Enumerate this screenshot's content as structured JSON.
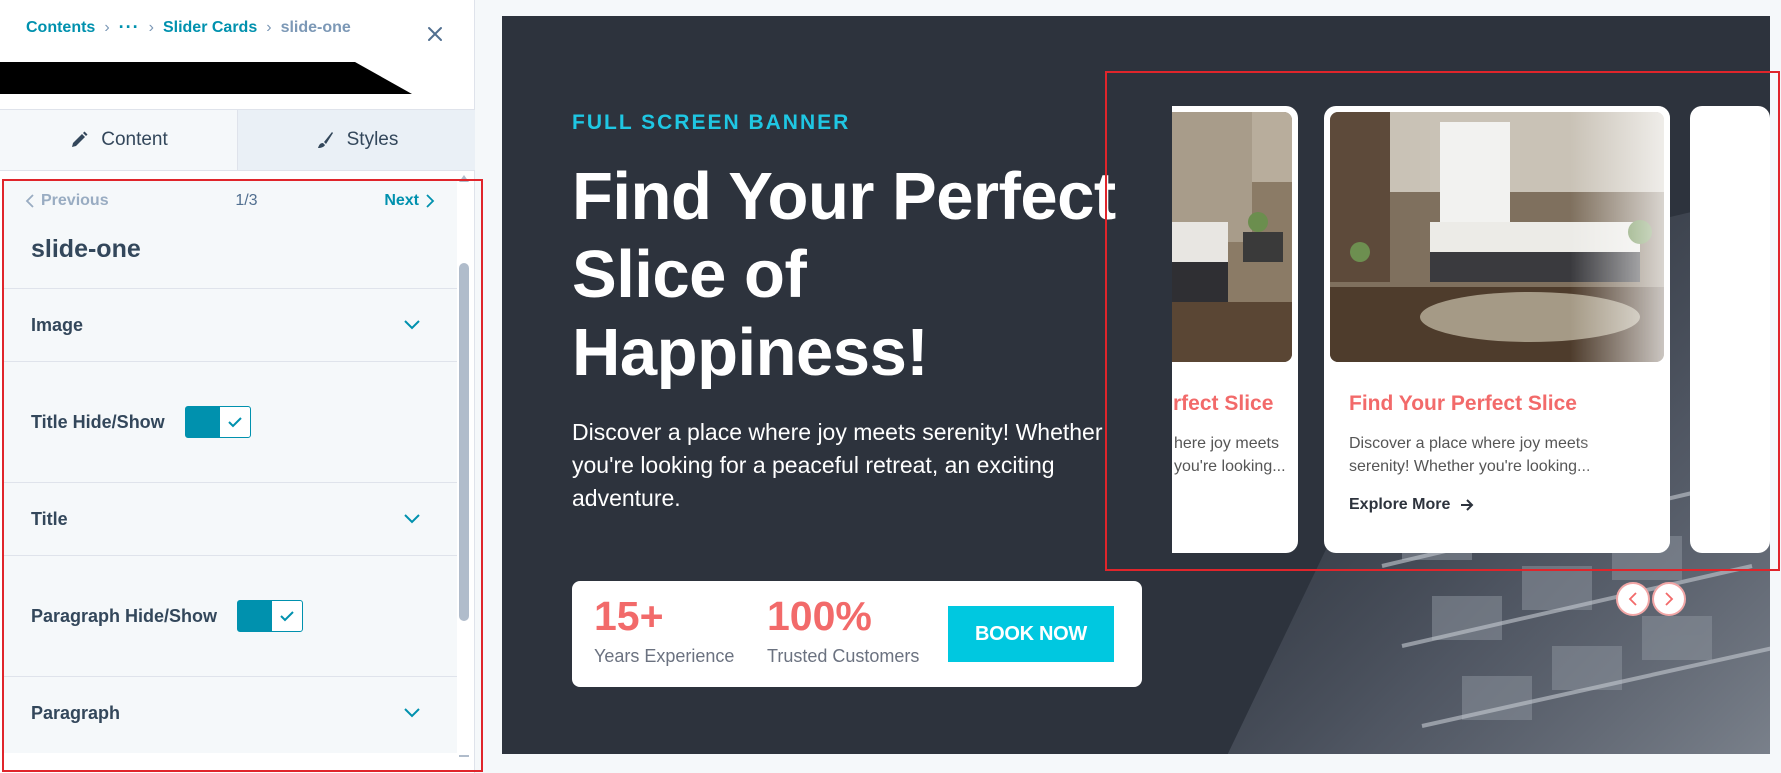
{
  "breadcrumb": {
    "items": [
      "Contents",
      "Slider Cards",
      "slide-one"
    ],
    "ellipsis": "···"
  },
  "tabs": [
    {
      "label": "Content",
      "icon": "pencil-icon",
      "active": true
    },
    {
      "label": "Styles",
      "icon": "brush-icon",
      "active": false
    }
  ],
  "pager": {
    "previous": "Previous",
    "count": "1/3",
    "next": "Next"
  },
  "slide_name": "slide-one",
  "fields": [
    {
      "label": "Image",
      "type": "accordion"
    },
    {
      "label": "Title Hide/Show",
      "type": "toggle",
      "checked": true
    },
    {
      "label": "Title",
      "type": "accordion"
    },
    {
      "label": "Paragraph Hide/Show",
      "type": "toggle",
      "checked": true
    },
    {
      "label": "Paragraph",
      "type": "accordion"
    }
  ],
  "banner": {
    "kicker": "FULL SCREEN BANNER",
    "headline_lines": [
      "Find Your Perfect",
      "Slice of",
      "Happiness!"
    ],
    "lead": "Discover a place where joy meets serenity! Whether you're looking for a peaceful retreat, an exciting adventure.",
    "stats": [
      {
        "value": "15+",
        "label": "Years Experience"
      },
      {
        "value": "100%",
        "label": "Trusted Customers"
      }
    ],
    "cta": "BOOK NOW"
  },
  "cards": [
    {
      "title": "Find Your Perfect Slice",
      "visible_title": "rfect Slice",
      "desc_lines": [
        "here joy meets",
        "you're looking..."
      ]
    },
    {
      "title": "Find Your Perfect Slice",
      "desc": "Discover a place where joy meets serenity! Whether you're looking...",
      "link": "Explore More"
    }
  ],
  "colors": {
    "accent": "#0091ae",
    "banner_bg": "#2d333d",
    "kicker": "#1fc7e3",
    "coral": "#f26a6a",
    "cta": "#00c8e0",
    "highlight": "#e0252b"
  }
}
